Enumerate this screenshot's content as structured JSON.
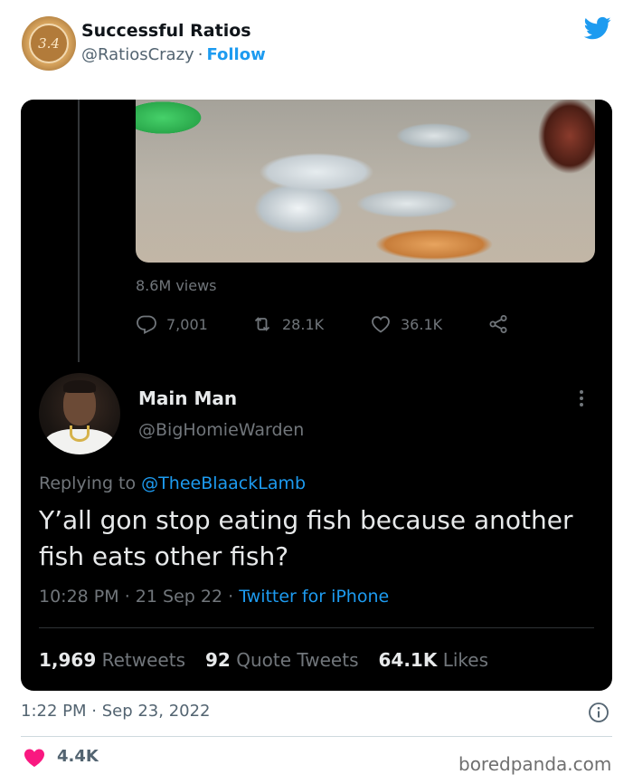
{
  "outer_tweet": {
    "author_name": "Successful Ratios",
    "author_handle": "@RatiosCrazy",
    "separator": "·",
    "follow_label": "Follow",
    "avatar_text": "3.4",
    "timestamp": "1:22 PM · Sep 23, 2022",
    "likes_count": "4.4K"
  },
  "embedded": {
    "original_tweet": {
      "views": "8.6M views",
      "replies": "7,001",
      "retweets": "28.1K",
      "likes": "36.1K"
    },
    "reply_tweet": {
      "author_name": "Main Man",
      "author_handle": "@BigHomieWarden",
      "replying_prefix": "Replying to",
      "replying_to": "@TheeBlaackLamb",
      "text": "Y’all gon stop eating fish because another fish eats other fish?",
      "time": "10:28 PM",
      "date": "21 Sep 22",
      "source": "Twitter for iPhone",
      "separator": "·",
      "stats": {
        "retweets_count": "1,969",
        "retweets_label": "Retweets",
        "quotes_count": "92",
        "quotes_label": "Quote Tweets",
        "likes_count": "64.1K",
        "likes_label": "Likes"
      }
    }
  },
  "watermark": "boredpanda.com",
  "colors": {
    "twitter_blue": "#1d9bf0",
    "like_red": "#f91880",
    "dark_bg": "#000000",
    "muted_gray": "#71767b"
  },
  "icons": [
    "twitter-bird-icon",
    "reply-icon",
    "retweet-icon",
    "like-icon",
    "share-icon",
    "more-icon",
    "info-icon",
    "heart-icon"
  ]
}
